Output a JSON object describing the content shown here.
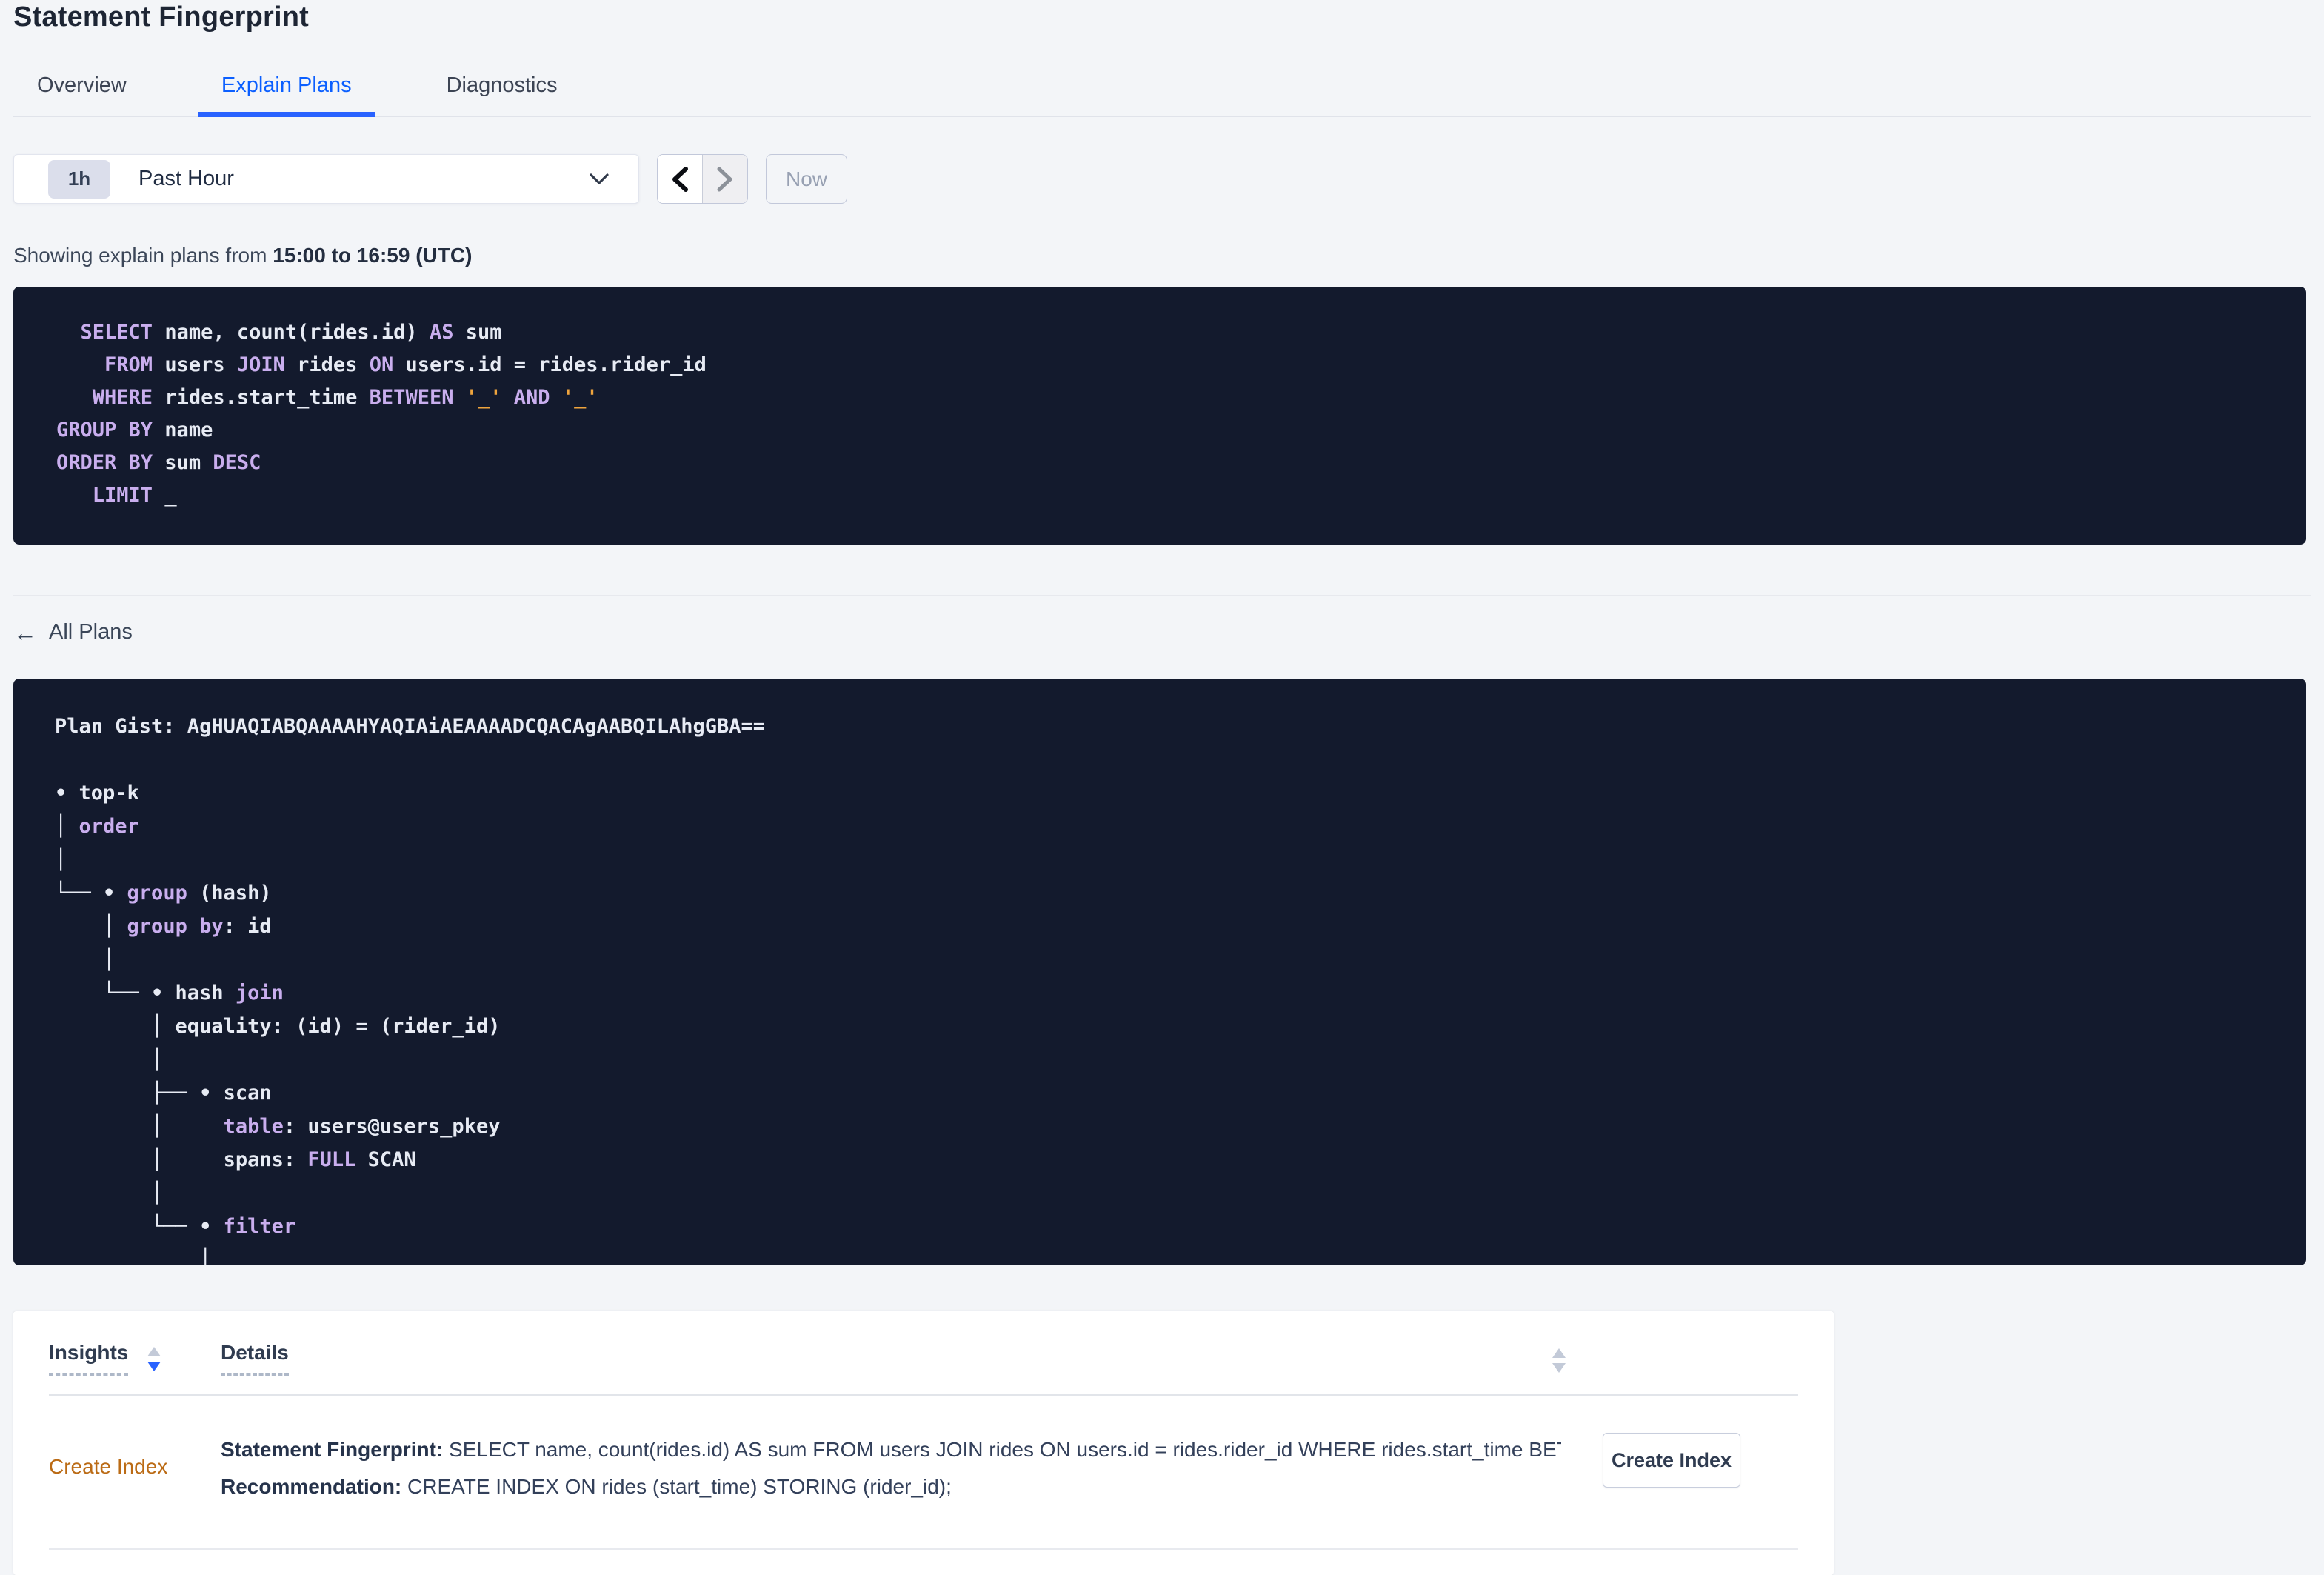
{
  "header": {
    "title": "Statement Fingerprint"
  },
  "tabs": [
    {
      "label": "Overview",
      "active": false
    },
    {
      "label": "Explain Plans",
      "active": true
    },
    {
      "label": "Diagnostics",
      "active": false
    }
  ],
  "time_picker": {
    "interval_badge": "1h",
    "selected_label": "Past Hour",
    "now_label": "Now"
  },
  "showing": {
    "prefix": "Showing explain plans from ",
    "range_bold": "15:00 to 16:59 (UTC)"
  },
  "sql": {
    "lines": [
      [
        {
          "t": "  ",
          "c": "p"
        },
        {
          "t": "SELECT",
          "c": "k"
        },
        {
          "t": " name, count(rides.id) ",
          "c": "p"
        },
        {
          "t": "AS",
          "c": "k"
        },
        {
          "t": " sum",
          "c": "p"
        }
      ],
      [
        {
          "t": "    ",
          "c": "p"
        },
        {
          "t": "FROM",
          "c": "k"
        },
        {
          "t": " users ",
          "c": "p"
        },
        {
          "t": "JOIN",
          "c": "k"
        },
        {
          "t": " rides ",
          "c": "p"
        },
        {
          "t": "ON",
          "c": "k"
        },
        {
          "t": " users.id = rides.rider_id",
          "c": "p"
        }
      ],
      [
        {
          "t": "   ",
          "c": "p"
        },
        {
          "t": "WHERE",
          "c": "k"
        },
        {
          "t": " rides.start_time ",
          "c": "p"
        },
        {
          "t": "BETWEEN",
          "c": "k"
        },
        {
          "t": " ",
          "c": "p"
        },
        {
          "t": "'_'",
          "c": "l"
        },
        {
          "t": " ",
          "c": "p"
        },
        {
          "t": "AND",
          "c": "k"
        },
        {
          "t": " ",
          "c": "p"
        },
        {
          "t": "'_'",
          "c": "l"
        }
      ],
      [
        {
          "t": "GROUP BY",
          "c": "k"
        },
        {
          "t": " name",
          "c": "p"
        }
      ],
      [
        {
          "t": "ORDER BY",
          "c": "k"
        },
        {
          "t": " sum ",
          "c": "p"
        },
        {
          "t": "DESC",
          "c": "k"
        }
      ],
      [
        {
          "t": "   ",
          "c": "p"
        },
        {
          "t": "LIMIT",
          "c": "k"
        },
        {
          "t": " _",
          "c": "p"
        }
      ]
    ]
  },
  "all_plans": {
    "icon_glyph": "←",
    "label": "All Plans"
  },
  "plan": {
    "gist": "AgHUAQIABQAAAAHYAQIAiAEAAAADCQACAgAABQILAhgGBA==",
    "lines": [
      [
        {
          "t": "Plan Gist: AgHUAQIABQAAAAHYAQIAiAEAAAADCQACAgAABQILAhgGBA==",
          "c": "p"
        }
      ],
      [
        {
          "t": "",
          "c": "p"
        }
      ],
      [
        {
          "t": "• top-k",
          "c": "p"
        }
      ],
      [
        {
          "t": "│ ",
          "c": "p"
        },
        {
          "t": "order",
          "c": "k"
        }
      ],
      [
        {
          "t": "│",
          "c": "p"
        }
      ],
      [
        {
          "t": "└── • ",
          "c": "p"
        },
        {
          "t": "group",
          "c": "k"
        },
        {
          "t": " (hash)",
          "c": "p"
        }
      ],
      [
        {
          "t": "    │ ",
          "c": "p"
        },
        {
          "t": "group by",
          "c": "k"
        },
        {
          "t": ": id",
          "c": "p"
        }
      ],
      [
        {
          "t": "    │",
          "c": "p"
        }
      ],
      [
        {
          "t": "    └── • hash ",
          "c": "p"
        },
        {
          "t": "join",
          "c": "k"
        }
      ],
      [
        {
          "t": "        │ equality: (id) = (rider_id)",
          "c": "p"
        }
      ],
      [
        {
          "t": "        │",
          "c": "p"
        }
      ],
      [
        {
          "t": "        ├── • scan",
          "c": "p"
        }
      ],
      [
        {
          "t": "        │     ",
          "c": "p"
        },
        {
          "t": "table",
          "c": "k"
        },
        {
          "t": ": users@users_pkey",
          "c": "p"
        }
      ],
      [
        {
          "t": "        │     spans: ",
          "c": "p"
        },
        {
          "t": "FULL",
          "c": "k"
        },
        {
          "t": " SCAN",
          "c": "p"
        }
      ],
      [
        {
          "t": "        │",
          "c": "p"
        }
      ],
      [
        {
          "t": "        └── • ",
          "c": "p"
        },
        {
          "t": "filter",
          "c": "k"
        }
      ],
      [
        {
          "t": "            │",
          "c": "p"
        }
      ],
      [
        {
          "t": "            │",
          "c": "p"
        }
      ]
    ]
  },
  "insights_table": {
    "columns": [
      {
        "label": "Insights",
        "sort": "desc"
      },
      {
        "label": "Details",
        "sort": "none"
      }
    ],
    "rows": [
      {
        "insight": "Create Index",
        "fingerprint_label": "Statement Fingerprint:",
        "fingerprint_text": " SELECT name, count(rides.id) AS sum FROM users JOIN rides ON users.id = rides.rider_id WHERE rides.start_time BETWEEN '_…",
        "recommendation_label": "Recommendation:",
        "recommendation_text": " CREATE INDEX ON rides (start_time) STORING (rider_id);",
        "action_label": "Create Index"
      }
    ]
  },
  "colors": {
    "accent_blue": "#2962ff",
    "tab_active_blue": "#0b5fff",
    "code_background": "#131a2d",
    "code_keyword_purple": "#c9aeee",
    "code_plain_white": "#e7ebf4",
    "code_literal_orange": "#efa43d",
    "insight_link_orange": "#bb6b15",
    "page_background": "#f3f5f8"
  }
}
